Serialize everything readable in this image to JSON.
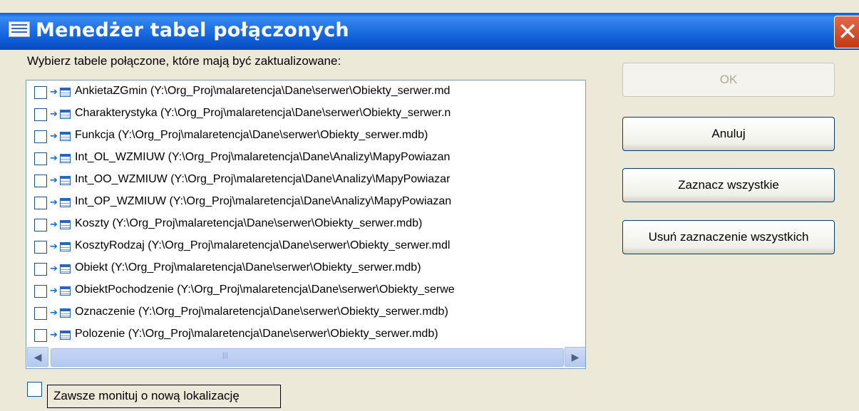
{
  "window": {
    "title": "Menedżer tabel połączonych",
    "close_glyph": "✕",
    "app_icon": "table-icon"
  },
  "prompt": "Wybierz tabele połączone, które mają być zaktualizowane:",
  "items": [
    "AnkietaZGmin   (Y:\\Org_Proj\\malaretencja\\Dane\\serwer\\Obiekty_serwer.md",
    "Charakterystyka   (Y:\\Org_Proj\\malaretencja\\Dane\\serwer\\Obiekty_serwer.n",
    "Funkcja   (Y:\\Org_Proj\\malaretencja\\Dane\\serwer\\Obiekty_serwer.mdb)",
    "Int_OL_WZMIUW   (Y:\\Org_Proj\\malaretencja\\Dane\\Analizy\\MapyPowiazan",
    "Int_OO_WZMIUW   (Y:\\Org_Proj\\malaretencja\\Dane\\Analizy\\MapyPowiazar",
    "Int_OP_WZMIUW   (Y:\\Org_Proj\\malaretencja\\Dane\\Analizy\\MapyPowiazan",
    "Koszty   (Y:\\Org_Proj\\malaretencja\\Dane\\serwer\\Obiekty_serwer.mdb)",
    "KosztyRodzaj   (Y:\\Org_Proj\\malaretencja\\Dane\\serwer\\Obiekty_serwer.mdl",
    "Obiekt   (Y:\\Org_Proj\\malaretencja\\Dane\\serwer\\Obiekty_serwer.mdb)",
    "ObiektPochodzenie   (Y:\\Org_Proj\\malaretencja\\Dane\\serwer\\Obiekty_serwe",
    "Oznaczenie   (Y:\\Org_Proj\\malaretencja\\Dane\\serwer\\Obiekty_serwer.mdb)",
    "Polozenie   (Y:\\Org_Proj\\malaretencja\\Dane\\serwer\\Obiekty_serwer.mdb)"
  ],
  "scroll": {
    "up": "▲",
    "down": "▼",
    "left": "◀",
    "right": "▶",
    "grip_v": "≡",
    "grip_h": "|||"
  },
  "buttons": {
    "ok": "OK",
    "cancel": "Anuluj",
    "select_all": "Zaznacz wszystkie",
    "deselect_all": "Usuń zaznaczenie wszystkich"
  },
  "always_prompt": "Zawsze monituj o nową lokalizację"
}
